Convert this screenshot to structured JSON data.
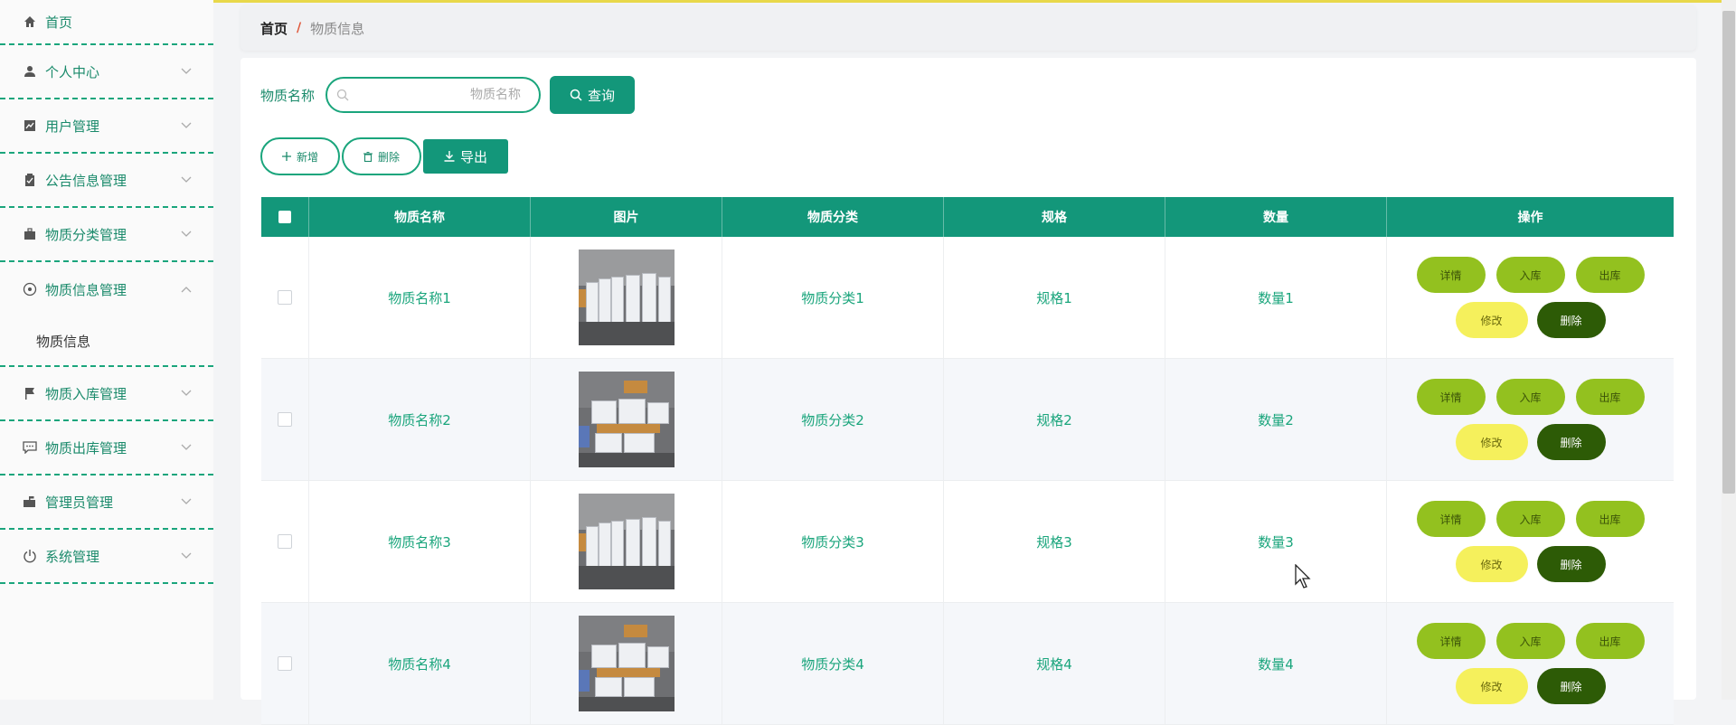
{
  "sidebar": {
    "items": [
      {
        "label": "首页",
        "icon": "home-icon"
      },
      {
        "label": "个人中心",
        "icon": "user-icon"
      },
      {
        "label": "用户管理",
        "icon": "chart-icon"
      },
      {
        "label": "公告信息管理",
        "icon": "clipboard-icon"
      },
      {
        "label": "物质分类管理",
        "icon": "briefcase-icon"
      },
      {
        "label": "物质信息管理",
        "icon": "compass-icon",
        "expanded": true,
        "sub": [
          {
            "label": "物质信息"
          }
        ]
      },
      {
        "label": "物质入库管理",
        "icon": "flag-icon"
      },
      {
        "label": "物质出库管理",
        "icon": "chat-icon"
      },
      {
        "label": "管理员管理",
        "icon": "mailbox-icon"
      },
      {
        "label": "系统管理",
        "icon": "power-icon"
      }
    ]
  },
  "breadcrumb": {
    "home": "首页",
    "separator": "/",
    "current": "物质信息"
  },
  "search": {
    "label": "物质名称",
    "placeholder": "物质名称",
    "button": "查询"
  },
  "actions": {
    "add": "新增",
    "delete": "删除",
    "export": "导出"
  },
  "table": {
    "headers": [
      "物质名称",
      "图片",
      "物质分类",
      "规格",
      "数量",
      "操作"
    ],
    "rows": [
      {
        "name": "物质名称1",
        "category": "物质分类1",
        "spec": "规格1",
        "quantity": "数量1"
      },
      {
        "name": "物质名称2",
        "category": "物质分类2",
        "spec": "规格2",
        "quantity": "数量2"
      },
      {
        "name": "物质名称3",
        "category": "物质分类3",
        "spec": "规格3",
        "quantity": "数量3"
      },
      {
        "name": "物质名称4",
        "category": "物质分类4",
        "spec": "规格4",
        "quantity": "数量4"
      }
    ],
    "ops": {
      "detail": "详情",
      "stock_in": "入库",
      "stock_out": "出库",
      "edit": "修改",
      "delete": "删除"
    }
  },
  "colors": {
    "primary": "#13977a",
    "text_green": "#1aa57c",
    "op_green": "#93c11f",
    "op_yellow": "#f5f05c",
    "op_dark": "#2d5b06"
  }
}
